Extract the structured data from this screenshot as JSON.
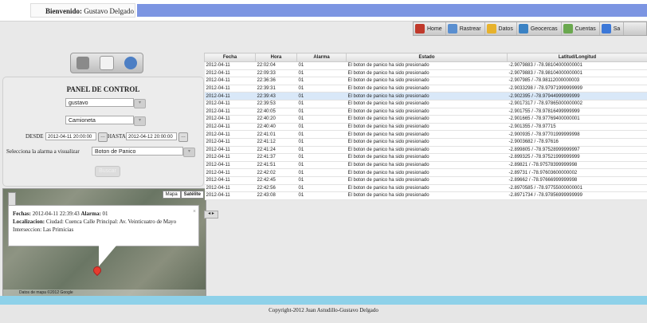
{
  "header": {
    "welcome_label": "Bienvenido:",
    "welcome_user": "Gustavo Delgado"
  },
  "nav": {
    "items": [
      {
        "label": "Home",
        "icon": "home-icon",
        "color": "#c0392b"
      },
      {
        "label": "Rastrear",
        "icon": "search-icon",
        "color": "#5a8fd0"
      },
      {
        "label": "Datos",
        "icon": "data-icon",
        "color": "#e7b22c"
      },
      {
        "label": "Geocercas",
        "icon": "globe-icon",
        "color": "#3b82c4"
      },
      {
        "label": "Cuentas",
        "icon": "users-icon",
        "color": "#6aa84f"
      },
      {
        "label": "Sa",
        "icon": "chart-icon",
        "color": "#3c78d8"
      }
    ]
  },
  "panel": {
    "title": "PANEL DE CONTROL",
    "user_select": "gustavo",
    "vehicle_select": "Camioneta",
    "desde_label": "DESDE",
    "desde_value": "2012-04-11 20:00:00",
    "hasta_label": "HASTA",
    "hasta_value": "2012-04-12 20:00:00",
    "alarm_label": "Selecciona la alarma a visualizar",
    "alarm_value": "Boton de Panico",
    "button_label": "Buscar"
  },
  "map": {
    "type_map": "Mapa",
    "type_satellite": "Satélite",
    "info_fechas_label": "Fechas:",
    "info_fechas_value": "2012-04-11 22:39:43",
    "info_alarma_label": "Alarma:",
    "info_alarma_value": "01",
    "info_loc_label": "Localizacion:",
    "info_loc_value": "Ciudad: Cuenca Calle Principal: Av. Veinticuatro de Mayo",
    "info_inter": "Interseccion: Las Primicias",
    "close": "×",
    "footer": "Datos de mapa ©2012 Google"
  },
  "table": {
    "headers": [
      "Fecha",
      "Hora",
      "Alarma",
      "Estado",
      "Latitud/Longitud"
    ],
    "selected_index": 4,
    "rows": [
      [
        "2012-04-11",
        "22:02:04",
        "01",
        "El boton de panico ha sido presionado",
        "-2.9079883 / -78.98104000000001"
      ],
      [
        "2012-04-11",
        "22:09:33",
        "01",
        "El boton de panico ha sido presionado",
        "-2.9079883 / -78.98104000000001"
      ],
      [
        "2012-04-11",
        "22:36:36",
        "01",
        "El boton de panico ha sido presionado",
        "-2.907985 / -78.98112000000003"
      ],
      [
        "2012-04-11",
        "22:39:31",
        "01",
        "El boton de panico ha sido presionado",
        "-2.9033298 / -78.97971999999999"
      ],
      [
        "2012-04-11",
        "22:39:43",
        "01",
        "El boton de panico ha sido presionado",
        "-2.902395 / -78.97944999999999"
      ],
      [
        "2012-04-11",
        "22:39:53",
        "01",
        "El boton de panico ha sido presionado",
        "-2.9017317 / -78.97865000000002"
      ],
      [
        "2012-04-11",
        "22:40:05",
        "01",
        "El boton de panico ha sido presionado",
        "-2.901755 / -78.97816499999999"
      ],
      [
        "2012-04-11",
        "22:40:20",
        "01",
        "El boton de panico ha sido presionado",
        "-2.901665 / -78.97769400000001"
      ],
      [
        "2012-04-11",
        "22:40:40",
        "01",
        "El boton de panico ha sido presionado",
        "-2.901355 / -78.97715"
      ],
      [
        "2012-04-11",
        "22:41:01",
        "01",
        "El boton de panico ha sido presionado",
        "-2.900935 / -78.97701999999998"
      ],
      [
        "2012-04-11",
        "22:41:12",
        "01",
        "El boton de panico ha sido presionado",
        "-2.9003682 / -78.97616"
      ],
      [
        "2012-04-11",
        "22:41:24",
        "01",
        "El boton de panico ha sido presionado",
        "-2.899805 / -78.97528999999997"
      ],
      [
        "2012-04-11",
        "22:41:37",
        "01",
        "El boton de panico ha sido presionado",
        "-2.899325 / -78.97521999999999"
      ],
      [
        "2012-04-11",
        "22:41:51",
        "01",
        "El boton de panico ha sido presionado",
        "-2.89821 / -78.97578399999998"
      ],
      [
        "2012-04-11",
        "22:42:02",
        "01",
        "El boton de panico ha sido presionado",
        "-2.89731 / -78.97603600000002"
      ],
      [
        "2012-04-11",
        "22:42:45",
        "01",
        "El boton de panico ha sido presionado",
        "-2.89662 / -78.97666999999998"
      ],
      [
        "2012-04-11",
        "22:42:56",
        "01",
        "El boton de panico ha sido presionado",
        "-2.8970585 / -78.97755000000001"
      ],
      [
        "2012-04-11",
        "22:43:08",
        "01",
        "El boton de panico ha sido presionado",
        "-2.8971734 / -78.97856999999999"
      ]
    ],
    "pager": "◂ ▸"
  },
  "footer": {
    "copyright": "Copyright-2012 Juan Astudillo-Gustavo Delgado"
  }
}
